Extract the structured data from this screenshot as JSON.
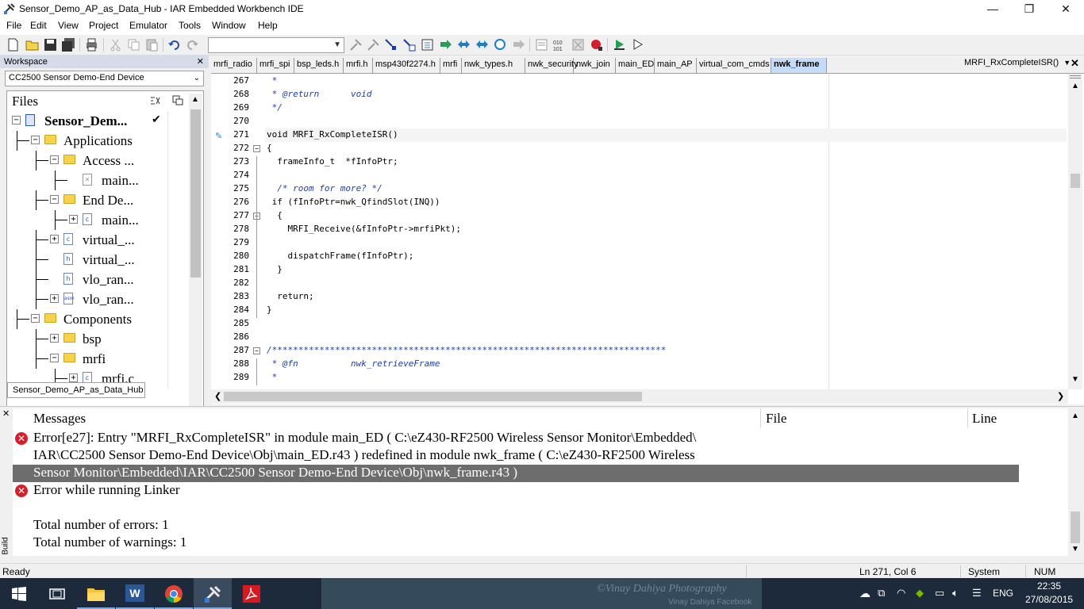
{
  "window": {
    "title": "Sensor_Demo_AP_as_Data_Hub - IAR Embedded Workbench IDE",
    "minimize_glyph": "—",
    "restore_glyph": "❐",
    "close_glyph": "✕"
  },
  "menu": [
    "File",
    "Edit",
    "View",
    "Project",
    "Emulator",
    "Tools",
    "Window",
    "Help"
  ],
  "workspace": {
    "title": "Workspace",
    "close_glyph": "✕",
    "config": "CC2500 Sensor Demo-End Device",
    "files_header": "Files",
    "check_glyph": "✔",
    "tree": [
      {
        "label": "Sensor_Dem...",
        "bold": true,
        "expander": "−",
        "icon": "project"
      },
      {
        "label": "Applications",
        "expander": "−",
        "icon": "folder"
      },
      {
        "label": "Access ...",
        "expander": "−",
        "icon": "folder"
      },
      {
        "label": "main...",
        "icon": "file-excluded",
        "icon_text": "✕"
      },
      {
        "label": "End De...",
        "expander": "−",
        "icon": "folder"
      },
      {
        "label": "main...",
        "expander": "+",
        "icon": "c-file",
        "icon_text": "c"
      },
      {
        "label": "virtual_...",
        "expander": "+",
        "icon": "c-file",
        "icon_text": "c"
      },
      {
        "label": "virtual_...",
        "icon": "h-file",
        "icon_text": "h"
      },
      {
        "label": "vlo_ran...",
        "icon": "h-file",
        "icon_text": "h"
      },
      {
        "label": "vlo_ran...",
        "expander": "+",
        "icon": "asm-file",
        "icon_text": "asm"
      },
      {
        "label": "Components",
        "expander": "−",
        "icon": "folder"
      },
      {
        "label": "bsp",
        "expander": "+",
        "icon": "folder"
      },
      {
        "label": "mrfi",
        "expander": "−",
        "icon": "folder"
      },
      {
        "label": "mrfi.c",
        "expander": "+",
        "icon": "c-file",
        "icon_text": "c"
      }
    ],
    "tab": "Sensor_Demo_AP_as_Data_Hub"
  },
  "editor": {
    "tabs": [
      "mrfi_radio",
      "mrfi_spi",
      "bsp_leds.h",
      "mrfi.h",
      "msp430f2274.h",
      "mrfi",
      "nwk_types.h",
      "nwk_security",
      "nwk_join",
      "main_ED",
      "main_AP",
      "virtual_com_cmds",
      "nwk_frame"
    ],
    "active_tab": "nwk_frame",
    "function_name": "MRFI_RxCompleteISR()",
    "close_glyph": "✕",
    "current_line": "271",
    "lines": [
      {
        "n": "267",
        "text": " *",
        "comment": true
      },
      {
        "n": "268",
        "text": " * @return      void",
        "comment": true
      },
      {
        "n": "269",
        "text": " */",
        "comment": true
      },
      {
        "n": "270",
        "text": ""
      },
      {
        "n": "271",
        "text": "void MRFI_RxCompleteISR()"
      },
      {
        "n": "272",
        "text": "{"
      },
      {
        "n": "273",
        "text": "  frameInfo_t  *fInfoPtr;"
      },
      {
        "n": "274",
        "text": ""
      },
      {
        "n": "275",
        "text": "  /* room for more? */",
        "comment": true
      },
      {
        "n": "276",
        "text": " if (fInfoPtr=nwk_QfindSlot(INQ))"
      },
      {
        "n": "277",
        "text": "  {"
      },
      {
        "n": "278",
        "text": "    MRFI_Receive(&fInfoPtr->mrfiPkt);"
      },
      {
        "n": "279",
        "text": ""
      },
      {
        "n": "280",
        "text": "    dispatchFrame(fInfoPtr);"
      },
      {
        "n": "281",
        "text": "  }"
      },
      {
        "n": "282",
        "text": ""
      },
      {
        "n": "283",
        "text": "  return;"
      },
      {
        "n": "284",
        "text": "}"
      },
      {
        "n": "285",
        "text": ""
      },
      {
        "n": "286",
        "text": ""
      },
      {
        "n": "287",
        "text": "/***************************************************************************",
        "comment": true
      },
      {
        "n": "288",
        "text": " * @fn          nwk_retrieveFrame",
        "comment": true
      },
      {
        "n": "289",
        "text": " *",
        "comment": true
      }
    ]
  },
  "build": {
    "side_close": "✕",
    "side_label": "Build",
    "headers": {
      "messages": "Messages",
      "file": "File",
      "line": "Line"
    },
    "lines": [
      {
        "text": "Error[e27]: Entry \"MRFI_RxCompleteISR\" in module main_ED ( C:\\eZ430-RF2500 Wireless Sensor Monitor\\Embedded\\",
        "error": true
      },
      {
        "text": "IAR\\CC2500 Sensor Demo-End Device\\Obj\\main_ED.r43 ) redefined in module nwk_frame ( C:\\eZ430-RF2500 Wireless"
      },
      {
        "text": "Sensor Monitor\\Embedded\\IAR\\CC2500 Sensor Demo-End Device\\Obj\\nwk_frame.r43 )",
        "selected": true
      },
      {
        "text": "Error while running Linker",
        "error": true
      },
      {
        "text": ""
      },
      {
        "text": "Total number of errors: 1"
      },
      {
        "text": "Total number of warnings: 1"
      }
    ]
  },
  "status": {
    "left": "Ready",
    "position": "Ln 271, Col 6",
    "encoding": "System",
    "numlock": "NUM"
  },
  "taskbar": {
    "watermark": "©Vinay Dahiya Photography",
    "watermark2": "Vinay Dahiya Facebook",
    "lang": "ENG",
    "time": "22:35",
    "date": "27/08/2015"
  }
}
